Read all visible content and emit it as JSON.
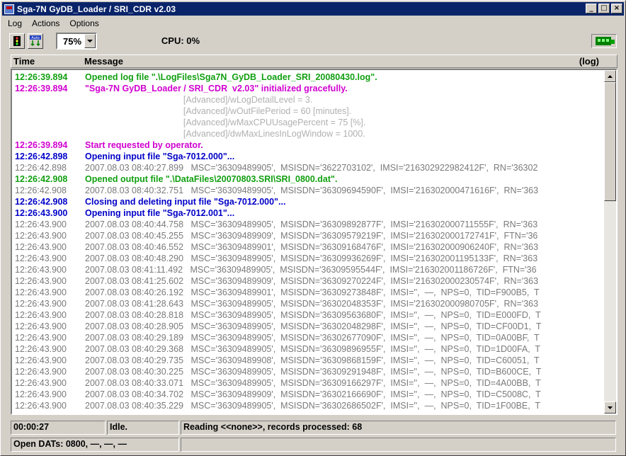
{
  "window": {
    "title": "Sga-7N GyDB_Loader / SRI_CDR  v2.03"
  },
  "menu": [
    {
      "label": "Log"
    },
    {
      "label": "Actions"
    },
    {
      "label": "Options"
    }
  ],
  "toolbar": {
    "zoom": "75%",
    "cpu_label": "CPU:",
    "cpu_value": "0%"
  },
  "log_header": {
    "time": "Time",
    "message": "Message",
    "log": "(log)"
  },
  "log_rows": [
    {
      "time": "12:26:39.894",
      "message": "Opened log file \".\\LogFiles\\Sga7N_GyDB_Loader_SRI_20080430.log\".",
      "color": "green"
    },
    {
      "time": "12:26:39.894",
      "message": "\"Sga-7N GyDB_Loader / SRI_CDR  v2.03\" initialized gracefully.",
      "color": "magenta"
    },
    {
      "time": "",
      "message": "                                        [Advanced]/wLogDetailLevel = 3.",
      "color": "lgray"
    },
    {
      "time": "",
      "message": "                                        [Advanced]/wOutFilePeriod = 60 [minutes].",
      "color": "lgray"
    },
    {
      "time": "",
      "message": "                                        [Advanced]/wMaxCPUUsagePercent = 75 [%].",
      "color": "lgray"
    },
    {
      "time": "",
      "message": "                                        [Advanced]/dwMaxLinesInLogWindow = 1000.",
      "color": "lgray"
    },
    {
      "time": "12:26:39.894",
      "message": "Start requested by operator.",
      "color": "magenta"
    },
    {
      "time": "12:26:42.898",
      "message": "Opening input file \"Sga-7012.000\"...",
      "color": "blue"
    },
    {
      "time": "12:26:42.898",
      "message": "2007.08.03 08:40:27.899   MSC='36309489905',  MSISDN='3622703102',  IMSI='216302922982412F',  RN='36302",
      "color": "gray"
    },
    {
      "time": "12:26:42.908",
      "message": "Opened output file \".\\DataFiles\\20070803.SRI\\SRI_0800.dat\".",
      "color": "green"
    },
    {
      "time": "12:26:42.908",
      "message": "2007.08.03 08:40:32.751   MSC='36309489905',  MSISDN='36309694590F',  IMSI='216302000471616F',  RN='363",
      "color": "gray"
    },
    {
      "time": "12:26:42.908",
      "message": "Closing and deleting input file \"Sga-7012.000\"...",
      "color": "blue"
    },
    {
      "time": "12:26:43.900",
      "message": "Opening input file \"Sga-7012.001\"...",
      "color": "blue"
    },
    {
      "time": "12:26:43.900",
      "message": "2007.08.03 08:40:44.758   MSC='36309489905',  MSISDN='36309892877F',  IMSI='216302000711555F',  RN='363",
      "color": "gray"
    },
    {
      "time": "12:26:43.900",
      "message": "2007.08.03 08:40:45.255   MSC='36309489909',  MSISDN='36309579219F',  IMSI='216302000172741F',  FTN='36",
      "color": "gray"
    },
    {
      "time": "12:26:43.900",
      "message": "2007.08.03 08:40:46.552   MSC='36309489901',  MSISDN='36309168476F',  IMSI='216302000906240F',  RN='363",
      "color": "gray"
    },
    {
      "time": "12:26:43.900",
      "message": "2007.08.03 08:40:48.290   MSC='36309489905',  MSISDN='36309936269F',  IMSI='216302001195133F',  RN='363",
      "color": "gray"
    },
    {
      "time": "12:26:43.900",
      "message": "2007.08.03 08:41:11.492   MSC='36309489905',  MSISDN='36309595544F',  IMSI='216302001186726F',  FTN='36",
      "color": "gray"
    },
    {
      "time": "12:26:43.900",
      "message": "2007.08.03 08:41:25.602   MSC='36309489909',  MSISDN='36309270224F',  IMSI='216302000230574F',  RN='363",
      "color": "gray"
    },
    {
      "time": "12:26:43.900",
      "message": "2007.08.03 08:40:26.192   MSC='36309489901',  MSISDN='36309273848F',  IMSI='',  —,  NPS=0,  TID=F900B5,  T",
      "color": "gray"
    },
    {
      "time": "12:26:43.900",
      "message": "2007.08.03 08:41:28.643   MSC='36309489905',  MSISDN='36302048353F',  IMSI='216302000980705F',  RN='363",
      "color": "gray"
    },
    {
      "time": "12:26:43.900",
      "message": "2007.08.03 08:40:28.818   MSC='36309489905',  MSISDN='36309563680F',  IMSI='',  —,  NPS=0,  TID=E000FD,  T",
      "color": "gray"
    },
    {
      "time": "12:26:43.900",
      "message": "2007.08.03 08:40:28.905   MSC='36309489905',  MSISDN='36302048298F',  IMSI='',  —,  NPS=0,  TID=CF00D1,  T",
      "color": "gray"
    },
    {
      "time": "12:26:43.900",
      "message": "2007.08.03 08:40:29.189   MSC='36309489905',  MSISDN='36302677090F',  IMSI='',  —,  NPS=0,  TID=0A00BF,  T",
      "color": "gray"
    },
    {
      "time": "12:26:43.900",
      "message": "2007.08.03 08:40:29.368   MSC='36309489905',  MSISDN='36309896955F',  IMSI='',  —,  NPS=0,  TID=1D00FA,  T",
      "color": "gray"
    },
    {
      "time": "12:26:43.900",
      "message": "2007.08.03 08:40:29.735   MSC='36309489908',  MSISDN='36309868159F',  IMSI='',  —,  NPS=0,  TID=C60051,  T",
      "color": "gray"
    },
    {
      "time": "12:26:43.900",
      "message": "2007.08.03 08:40:30.225   MSC='36309489905',  MSISDN='36309291948F',  IMSI='',  —,  NPS=0,  TID=B600CE,  T",
      "color": "gray"
    },
    {
      "time": "12:26:43.900",
      "message": "2007.08.03 08:40:33.071   MSC='36309489905',  MSISDN='36309166297F',  IMSI='',  —,  NPS=0,  TID=4A00BB,  T",
      "color": "gray"
    },
    {
      "time": "12:26:43.900",
      "message": "2007.08.03 08:40:34.702   MSC='36309489909',  MSISDN='36302166690F',  IMSI='',  —,  NPS=0,  TID=C5008C,  T",
      "color": "gray"
    },
    {
      "time": "12:26:43.900",
      "message": "2007.08.03 08:40:35.229   MSC='36309489905',  MSISDN='36302686502F',  IMSI='',  —,  NPS=0,  TID=1F00BE,  T",
      "color": "gray"
    }
  ],
  "statusbar": {
    "elapsed": "00:00:27",
    "state": "Idle.",
    "progress": "Reading <<none>>, records processed: 68",
    "open_dats": "Open DATs: 0800, —, —, —",
    "extra": ""
  },
  "colors": {
    "green": "#12a012",
    "magenta": "#d000d0",
    "blue": "#0000c8",
    "gray": "#7a7a7a",
    "title_bar": "#0a246a"
  }
}
